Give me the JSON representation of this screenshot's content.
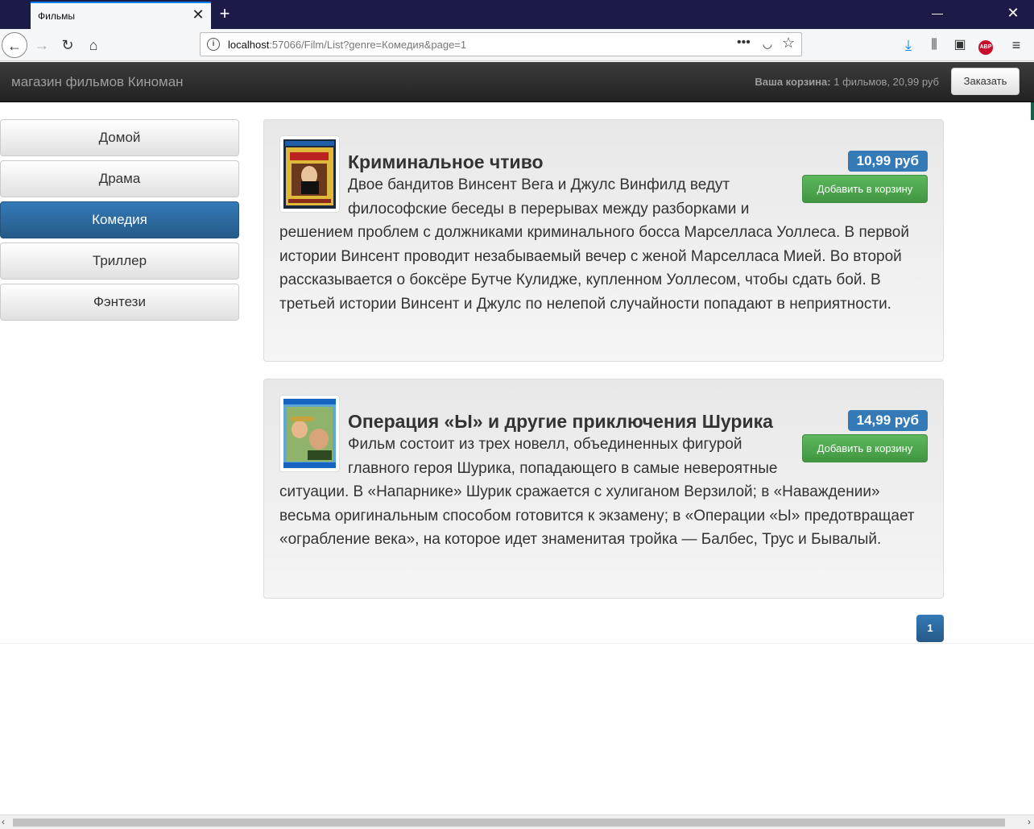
{
  "browser": {
    "tab_title": "Фильмы",
    "tab_close": "✕",
    "new_tab": "+",
    "url_host": "localhost",
    "url_rest": ":57066/Film/List?genre=Комедия&page=1"
  },
  "site": {
    "brand": "магазин фильмов Киноман",
    "cart_label": "Ваша корзина:",
    "cart_value": " 1 фильмов, 20,99 руб",
    "order_button": "Заказать"
  },
  "genres": [
    "Домой",
    "Драма",
    "Комедия",
    "Триллер",
    "Фэнтези"
  ],
  "active_genre": "Комедия",
  "films": [
    {
      "title": "Криминальное чтиво",
      "price": "10,99 руб",
      "add_button": "Добавить в корзину",
      "description": "Двое бандитов Винсент Вега и Джулс Винфилд ведут философские беседы в перерывах между разборками и решением проблем с должниками криминального босса Марселласа Уоллеса. В первой истории Винсент проводит незабываемый вечер с женой Марселласа Мией. Во второй рассказывается о боксёре Бутче Кулидже, купленном Уоллесом, чтобы сдать бой. В третьей истории Винсент и Джулс по нелепой случайности попадают в неприятности."
    },
    {
      "title": "Операция «Ы» и другие приключения Шурика",
      "price": "14,99 руб",
      "add_button": "Добавить в корзину",
      "description": "Фильм состоит из трех новелл, объединенных фигурой главного героя Шурика, попадающего в самые невероятные ситуации. В «Напарнике» Шурик сражается с хулиганом Верзилой; в «Наваждении» весьма оригинальным способом готовится к экзамену; в «Операции «Ы» предотвращает «ограбление века», на которое идет знаменитая тройка — Балбес, Трус и Бывалый."
    }
  ],
  "pagination": {
    "current": "1"
  }
}
